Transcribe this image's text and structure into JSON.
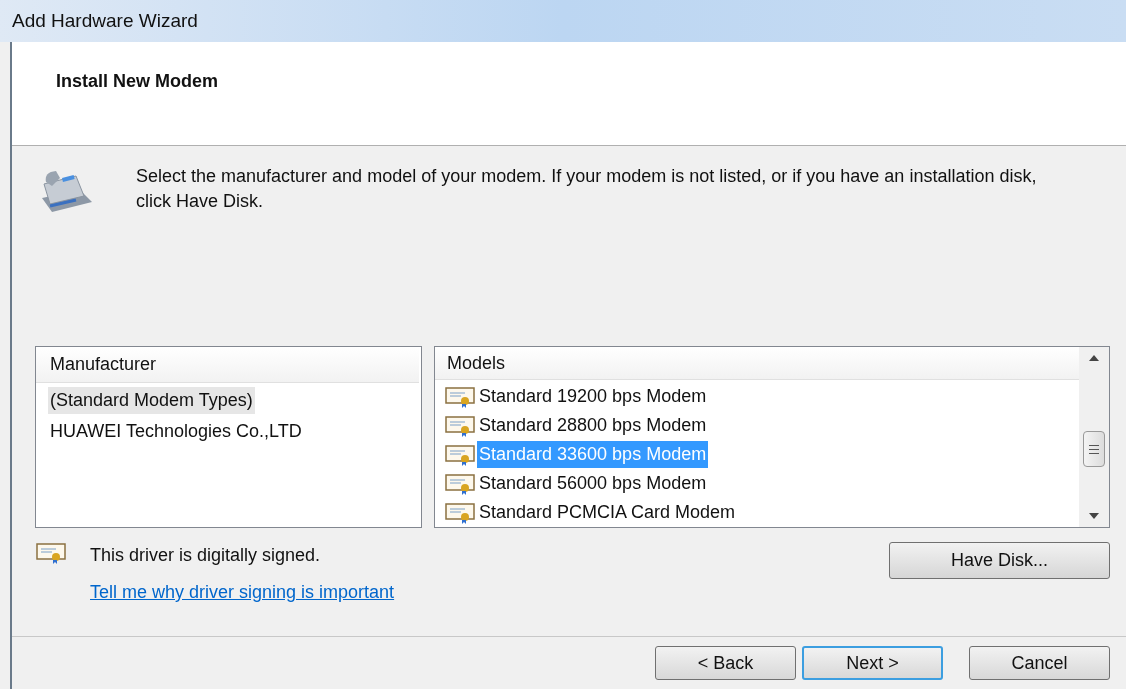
{
  "window": {
    "title": "Add Hardware Wizard"
  },
  "header": {
    "title": "Install New Modem"
  },
  "instruction": "Select the manufacturer and model of your modem. If your modem is not listed, or if you have an installation disk, click Have Disk.",
  "manufacturers": {
    "heading": "Manufacturer",
    "items": [
      {
        "label": "(Standard Modem Types)",
        "selected": true
      },
      {
        "label": "HUAWEI Technologies Co.,LTD",
        "selected": false
      }
    ]
  },
  "models": {
    "heading": "Models",
    "items": [
      {
        "label": "Standard 19200 bps Modem",
        "selected": false
      },
      {
        "label": "Standard 28800 bps Modem",
        "selected": false
      },
      {
        "label": "Standard 33600 bps Modem",
        "selected": true
      },
      {
        "label": "Standard 56000 bps Modem",
        "selected": false
      },
      {
        "label": "Standard PCMCIA Card Modem",
        "selected": false
      }
    ]
  },
  "signing": {
    "status": "This driver is digitally signed.",
    "link": "Tell me why driver signing is important"
  },
  "have_disk_button": "Have Disk...",
  "buttons": [
    {
      "label": "< Back",
      "default": false
    },
    {
      "label": "Next >",
      "default": true
    },
    {
      "label": "Cancel",
      "default": false
    }
  ]
}
